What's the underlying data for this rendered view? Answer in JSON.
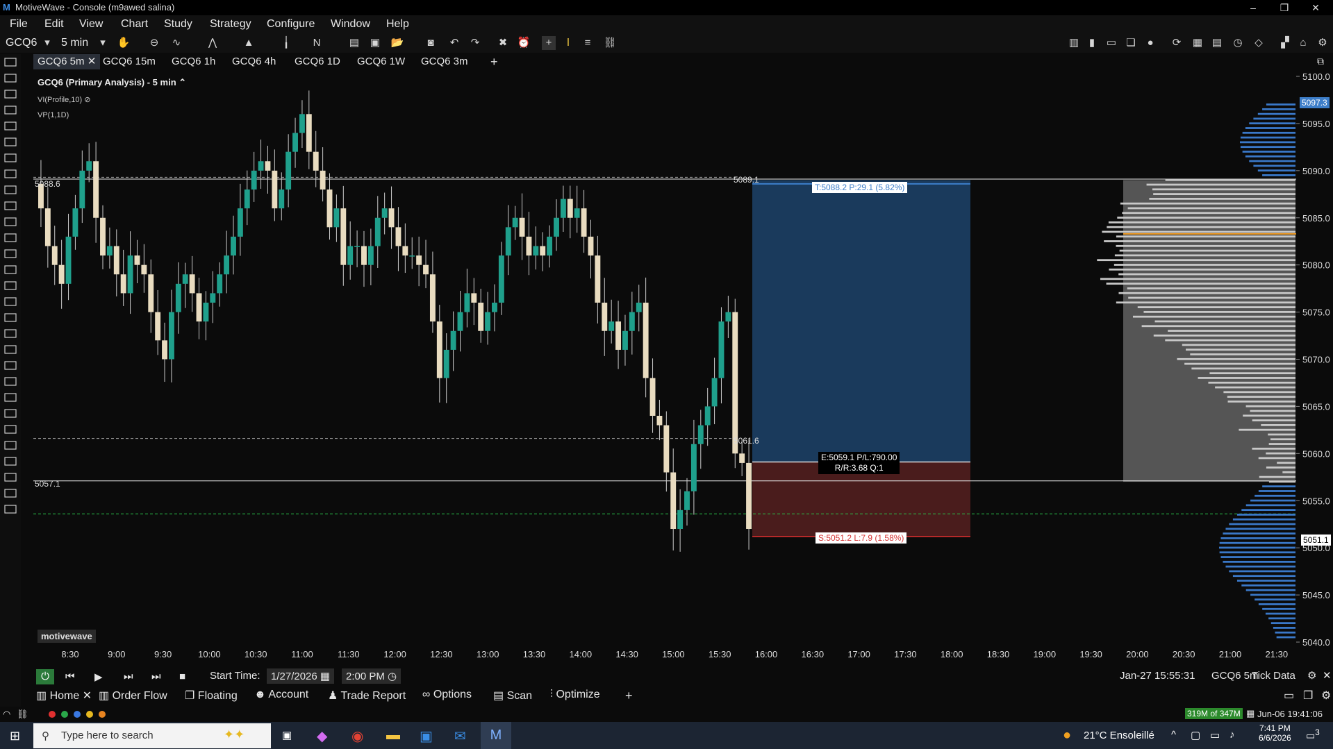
{
  "window": {
    "title": "MotiveWave - Console (m9awed salina)",
    "logo_icon": "motivewave-logo-icon"
  },
  "menubar": {
    "items": [
      "File",
      "Edit",
      "View",
      "Chart",
      "Study",
      "Strategy",
      "Configure",
      "Window",
      "Help"
    ]
  },
  "toolbar": {
    "symbol": "GCQ6",
    "interval": "5 min"
  },
  "tabs": [
    {
      "label": "GCQ6 5m",
      "active": true
    },
    {
      "label": "GCQ6 15m"
    },
    {
      "label": "GCQ6 1h"
    },
    {
      "label": "GCQ6 4h"
    },
    {
      "label": "GCQ6 1D"
    },
    {
      "label": "GCQ6 1W"
    },
    {
      "label": "GCQ6 3m"
    }
  ],
  "chart_header": {
    "title": "GCQ6 (Primary Analysis) - 5 min",
    "study1": "VI(Profile,10)",
    "study2": "VP(1,1D)"
  },
  "price_axis": {
    "ticks": [
      "5100.0",
      "5095.0",
      "5090.0",
      "5085.0",
      "5080.0",
      "5075.0",
      "5070.0",
      "5065.0",
      "5060.0",
      "5055.0",
      "5050.0",
      "5045.0",
      "5040.0"
    ],
    "current": "5097.3",
    "last": "5051.1"
  },
  "time_axis": {
    "ticks": [
      "8:30",
      "9:00",
      "9:30",
      "10:00",
      "10:30",
      "11:00",
      "11:30",
      "12:00",
      "12:30",
      "13:00",
      "13:30",
      "14:00",
      "14:30",
      "15:00",
      "15:30",
      "16:00",
      "16:30",
      "17:00",
      "17:30",
      "18:00",
      "18:30",
      "19:00",
      "19:30",
      "20:00",
      "20:30",
      "21:00",
      "21:30"
    ]
  },
  "levels": {
    "left_top": "5088.6",
    "mid_top": "5089.1",
    "mid": "5061.6",
    "left_low": "5057.1"
  },
  "trade": {
    "target": "T:5088.2 P:29.1 (5.82%)",
    "entry1": "E:5059.1 P/L:790.00",
    "entry2": "R/R:3.68 Q:1",
    "stop": "S:5051.2 L:7.9 (1.58%)"
  },
  "watermark": "motivewave",
  "replay": {
    "start_label": "Start Time:",
    "date": "1/27/2026",
    "time": "2:00 PM"
  },
  "status": {
    "datetime": "Jan-27 15:55:31",
    "symbol": "GCQ6 5m",
    "mode": "Tick Data"
  },
  "panels": [
    "Home",
    "Order Flow",
    "Floating",
    "Account",
    "Trade Report",
    "Options",
    "Scan",
    "Optimize"
  ],
  "memory": {
    "usage": "319M of 347M",
    "clock": "Jun-06 19:41:06"
  },
  "taskbar": {
    "search_placeholder": "Type here to search",
    "weather": "21°C  Ensoleillé",
    "time": "7:41 PM",
    "date": "6/6/2026",
    "notifications": "3"
  },
  "colors": {
    "bull": "#1fa08c",
    "bear": "#e9dcc0",
    "target_zone": "#1a3a5c",
    "stop_zone": "#4a1c1c",
    "profile": "#3a78c8"
  }
}
